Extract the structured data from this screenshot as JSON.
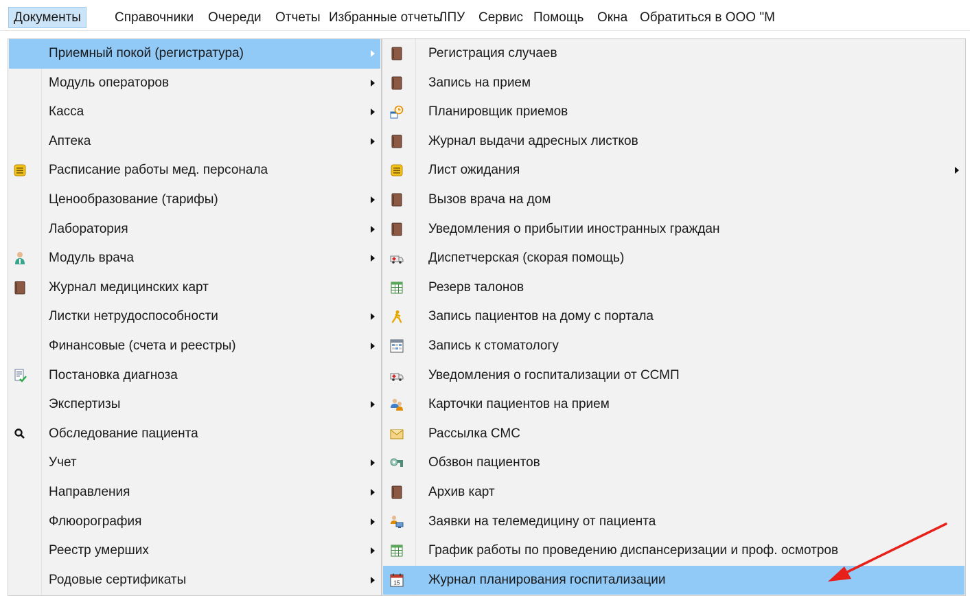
{
  "menubar": {
    "items": [
      {
        "label": "Документы",
        "active": true
      },
      {
        "label": "Справочники"
      },
      {
        "label": "Очереди"
      },
      {
        "label": "Отчеты"
      },
      {
        "label": "Избранные отчеты"
      },
      {
        "label": "ЛПУ"
      },
      {
        "label": "Сервис"
      },
      {
        "label": "Помощь"
      },
      {
        "label": "Окна"
      },
      {
        "label": "Обратиться в ООО \"М"
      }
    ]
  },
  "main_menu": {
    "items": [
      {
        "label": "Приемный покой (регистратура)",
        "submenu": true,
        "highlighted": true
      },
      {
        "label": "Модуль операторов",
        "submenu": true
      },
      {
        "label": "Касса",
        "submenu": true
      },
      {
        "label": "Аптека",
        "submenu": true
      },
      {
        "label": "Расписание работы мед. персонала",
        "icon": "note-list-icon"
      },
      {
        "label": "Ценообразование (тарифы)",
        "submenu": true
      },
      {
        "label": "Лаборатория",
        "submenu": true
      },
      {
        "label": "Модуль врача",
        "submenu": true,
        "icon": "doctor-icon"
      },
      {
        "label": "Журнал медицинских карт",
        "icon": "book-icon"
      },
      {
        "label": "Листки нетрудоспособности",
        "submenu": true
      },
      {
        "label": "Финансовые (счета и реестры)",
        "submenu": true
      },
      {
        "label": "Постановка диагноза",
        "icon": "diagnosis-icon"
      },
      {
        "label": "Экспертизы",
        "submenu": true
      },
      {
        "label": "Обследование пациента",
        "icon": "search-icon"
      },
      {
        "label": "Учет",
        "submenu": true
      },
      {
        "label": "Направления",
        "submenu": true
      },
      {
        "label": "Флюорография",
        "submenu": true
      },
      {
        "label": "Реестр умерших",
        "submenu": true
      },
      {
        "label": "Родовые сертификаты",
        "submenu": true
      }
    ]
  },
  "sub_menu": {
    "items": [
      {
        "label": "Регистрация случаев",
        "icon": "book-icon"
      },
      {
        "label": "Запись на прием",
        "icon": "book-icon"
      },
      {
        "label": "Планировщик приемов",
        "icon": "scheduler-clock-icon"
      },
      {
        "label": "Журнал выдачи адресных листков",
        "icon": "book-icon"
      },
      {
        "label": "Лист ожидания",
        "icon": "note-list-icon",
        "submenu": true
      },
      {
        "label": "Вызов врача на дом",
        "icon": "book-icon"
      },
      {
        "label": "Уведомления о прибытии иностранных граждан",
        "icon": "book-icon"
      },
      {
        "label": "Диспетчерская (скорая помощь)",
        "icon": "ambulance-icon"
      },
      {
        "label": "Резерв талонов",
        "icon": "grid-table-icon"
      },
      {
        "label": "Запись пациентов на дому с портала",
        "icon": "person-walking-icon"
      },
      {
        "label": "Запись к стоматологу",
        "icon": "schedule-board-icon"
      },
      {
        "label": "Уведомления о госпитализации от ССМП",
        "icon": "ambulance-icon"
      },
      {
        "label": "Карточки пациентов на прием",
        "icon": "patients-icon"
      },
      {
        "label": "Рассылка СМС",
        "icon": "envelope-icon"
      },
      {
        "label": "Обзвон пациентов",
        "icon": "phone-call-icon"
      },
      {
        "label": "Архив карт",
        "icon": "book-icon"
      },
      {
        "label": "Заявки на телемедицину от пациента",
        "icon": "telemedicine-icon"
      },
      {
        "label": "График работы по проведению диспансеризации и проф. осмотров",
        "icon": "grid-table-icon"
      },
      {
        "label": "Журнал планирования госпитализации",
        "icon": "calendar-icon",
        "highlighted": true
      }
    ]
  },
  "annotation": {
    "color": "#e8201a"
  },
  "colors": {
    "highlight": "#91c9f7",
    "menubar_active": "#cce4f7",
    "menu_bg": "#f2f2f2"
  }
}
